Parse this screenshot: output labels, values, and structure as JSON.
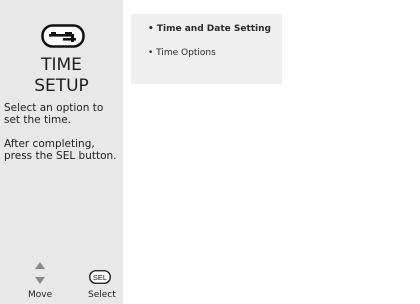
{
  "sidebar": {
    "icon": "setup-wrench-icon",
    "title_line1": "TIME",
    "title_line2": "SETUP",
    "instruction_1": "Select an option to set the time.",
    "instruction_2": "After completing, press the SEL button.",
    "nav_icon": "up-down-arrows-icon",
    "move_label": "Move",
    "select_icon_text": "SEL",
    "select_label": "Select"
  },
  "menu": {
    "items": [
      {
        "label": "• Time and Date Setting",
        "selected": true
      },
      {
        "label": "• Time Options",
        "selected": false
      }
    ]
  },
  "colors": {
    "sidebar_bg": "#e8e8e8",
    "menu_bg": "#efefef",
    "arrow": "#8a8a8a"
  }
}
